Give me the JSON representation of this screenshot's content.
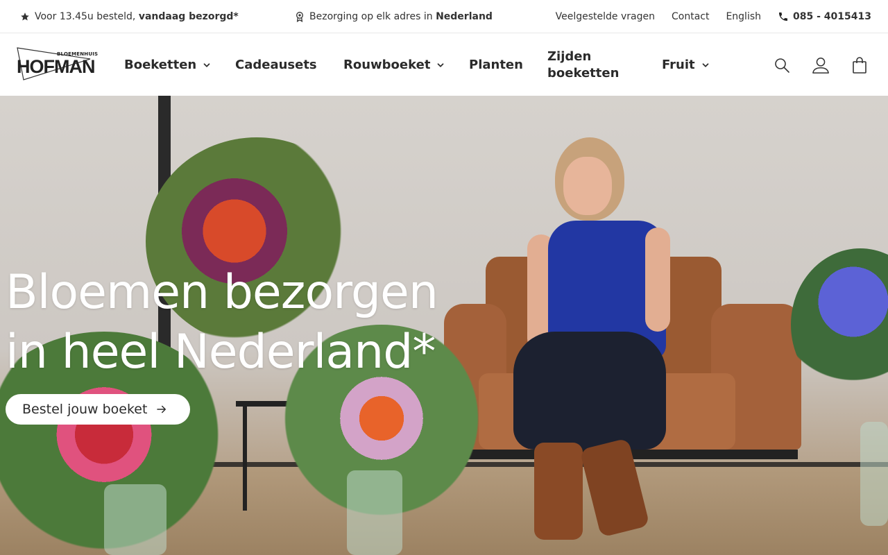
{
  "topbar": {
    "usp_order": {
      "text": "Voor 13.45u besteld, ",
      "bold": "vandaag bezorgd*",
      "icon": "star-icon"
    },
    "usp_delivery": {
      "text": "Bezorging op elk adres in ",
      "bold": "Nederland",
      "icon": "award-icon"
    },
    "links": {
      "faq": "Veelgestelde vragen",
      "contact": "Contact",
      "language": "English"
    },
    "phone": {
      "number": "085 - 4015413",
      "icon": "phone-icon"
    }
  },
  "header": {
    "logo": {
      "small": "BLOEMENHUIS",
      "big": "HOFMAN"
    },
    "nav": [
      {
        "label": "Boeketten",
        "has_dropdown": true
      },
      {
        "label": "Cadeausets",
        "has_dropdown": false
      },
      {
        "label": "Rouwboeket",
        "has_dropdown": true
      },
      {
        "label": "Planten",
        "has_dropdown": false
      },
      {
        "label": "Zijden boeketten",
        "has_dropdown": false
      },
      {
        "label": "Fruit",
        "has_dropdown": true
      }
    ],
    "icons": [
      "search-icon",
      "account-icon",
      "cart-icon"
    ]
  },
  "hero": {
    "title_line1": "Bloemen bezorgen",
    "title_line2": "in heel Nederland*",
    "cta_label": "Bestel jouw boeket"
  },
  "colors": {
    "text": "#2b2b2b",
    "hero_text": "#ffffff",
    "cta_bg": "#ffffff"
  }
}
